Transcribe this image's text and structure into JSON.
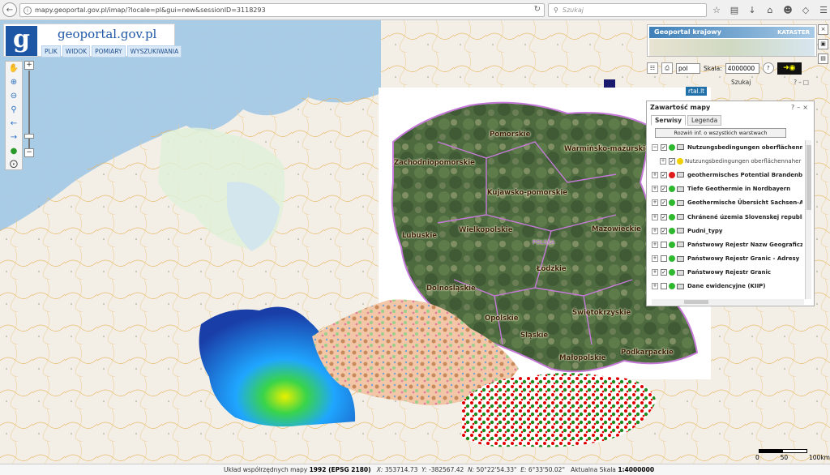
{
  "browser": {
    "url": "mapy.geoportal.gov.pl/imap/?locale=pl&gui=new&sessionID=3118293",
    "search_placeholder": "Szukaj"
  },
  "logo": {
    "letter": "g",
    "text": "geoportal.gov.pl",
    "menu": [
      "PLIK",
      "WIDOK",
      "POMIARY",
      "WYSZUKIWANIA"
    ]
  },
  "top_right": {
    "banner": "Geoportal krajowy",
    "kataster": "KATASTER",
    "language": "pol",
    "scale_label": "Skala:",
    "scale_value": "4000000"
  },
  "search_panel": {
    "title": "Szukaj",
    "tag": "rtal.lt"
  },
  "map_content": {
    "title": "Zawartość mapy",
    "tabs": [
      "Serwisy",
      "Legenda"
    ],
    "expand_button": "Rozwiń inf. o wszystkich warstwach",
    "layers": [
      {
        "label": "Nutzungsbedingungen oberflächennaher G",
        "checked": true,
        "dot": "#2db82d",
        "sub": false
      },
      {
        "label": "Nutzungsbedingungen oberflächennaher G",
        "checked": true,
        "dot": "#f0d000",
        "sub": true
      },
      {
        "label": "geothermisches Potential Brandenburg",
        "checked": true,
        "dot": "#e01b1b",
        "sub": false
      },
      {
        "label": "Tiefe Geothermie in Nordbayern",
        "checked": true,
        "dot": "#2db82d",
        "sub": false
      },
      {
        "label": "Geothermische Übersicht Sachsen-Anhalt",
        "checked": true,
        "dot": "#2db82d",
        "sub": false
      },
      {
        "label": "Chránené územia Slovenskej republiky",
        "checked": true,
        "dot": "#2db82d",
        "sub": false
      },
      {
        "label": "Pudni_typy",
        "checked": true,
        "dot": "#2db82d",
        "sub": false
      },
      {
        "label": "Państwowy Rejestr Nazw Geograficznych",
        "checked": false,
        "dot": "#2db82d",
        "sub": false
      },
      {
        "label": "Państwowy Rejestr Granic - Adresy",
        "checked": false,
        "dot": "#2db82d",
        "sub": false
      },
      {
        "label": "Państwowy Rejestr Granic",
        "checked": true,
        "dot": "#2db82d",
        "sub": false
      },
      {
        "label": "Dane ewidencyjne (KIIP)",
        "checked": false,
        "dot": "#2db82d",
        "sub": false
      }
    ]
  },
  "regions": [
    "Pomorskie",
    "Warmińsko-mazurskie",
    "Zachodniopomorskie",
    "Kujawsko-pomorskie",
    "Mazowieckie",
    "Wielkopolskie",
    "Lubuskie",
    "POLSKA",
    "Łódzkie",
    "Dolnośląskie",
    "Opolskie",
    "Świętokrzyskie",
    "Śląskie",
    "Małopolskie",
    "Podkarpackie"
  ],
  "scale_bar": {
    "labels": [
      "0",
      "50",
      "100km"
    ]
  },
  "status": {
    "crs_label": "Układ współrzędnych mapy",
    "crs_value": "1992 (EPSG 2180)",
    "x_label": "X:",
    "x_value": "353714.73",
    "y_label": "Y:",
    "y_value": "-382567.42",
    "n_label": "N:",
    "n_value": "50°22'54.33\"",
    "e_label": "E:",
    "e_value": "6°33'50.02\"",
    "scale_label": "Aktualna Skala",
    "scale_value": "1:4000000"
  }
}
